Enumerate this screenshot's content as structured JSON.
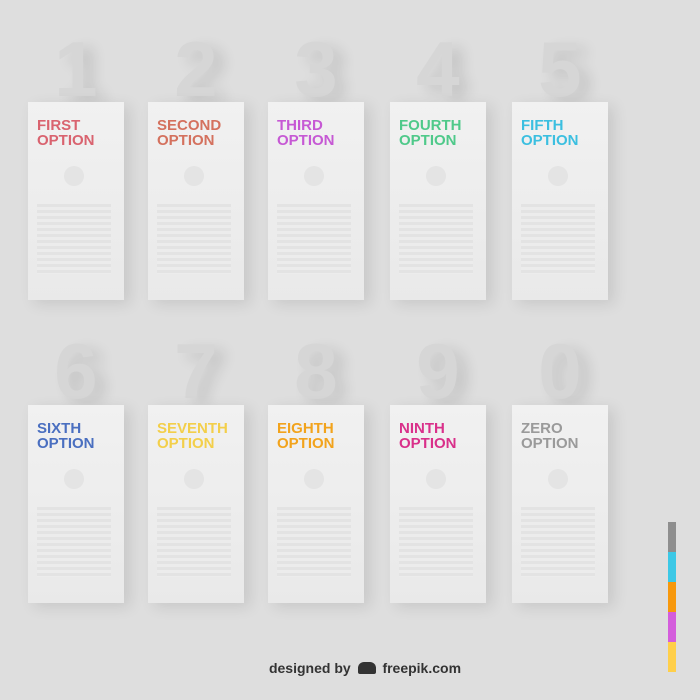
{
  "options": [
    {
      "number": "1",
      "title_line1": "FIRST",
      "title_line2": "OPTION",
      "color": "#d9636f"
    },
    {
      "number": "2",
      "title_line1": "SECOND",
      "title_line2": "OPTION",
      "color": "#d4715e"
    },
    {
      "number": "3",
      "title_line1": "THIRD",
      "title_line2": "OPTION",
      "color": "#c659d4"
    },
    {
      "number": "4",
      "title_line1": "FOURTH",
      "title_line2": "OPTION",
      "color": "#4fc98a"
    },
    {
      "number": "5",
      "title_line1": "FIFTH",
      "title_line2": "OPTION",
      "color": "#3bbfe0"
    },
    {
      "number": "6",
      "title_line1": "SIXTH",
      "title_line2": "OPTION",
      "color": "#4a6fc0"
    },
    {
      "number": "7",
      "title_line1": "SEVENTH",
      "title_line2": "OPTION",
      "color": "#f3cf4a"
    },
    {
      "number": "8",
      "title_line1": "EIGHTH",
      "title_line2": "OPTION",
      "color": "#f2a31c"
    },
    {
      "number": "9",
      "title_line1": "NINTH",
      "title_line2": "OPTION",
      "color": "#d9308a"
    },
    {
      "number": "0",
      "title_line1": "ZERO",
      "title_line2": "OPTION",
      "color": "#9a9a9a"
    }
  ],
  "palette": [
    "#8e8e8e",
    "#3cc8e6",
    "#f7980c",
    "#d45ddc",
    "#ffcf4a"
  ],
  "footer": {
    "designed_by": "designed by",
    "brand": "freepik.com"
  }
}
